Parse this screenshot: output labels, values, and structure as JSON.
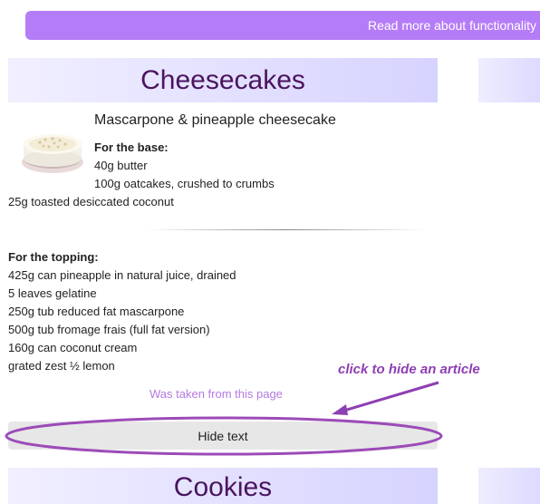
{
  "topbar": {
    "link_label": "Read more about functionality"
  },
  "section": {
    "title": "Cheesecakes"
  },
  "article": {
    "title": "Mascarpone & pineapple cheesecake",
    "base_heading": "For the base:",
    "base_items": [
      "40g butter",
      "100g oatcakes, crushed to crumbs",
      "25g toasted desiccated coconut"
    ],
    "topping_heading": "For the topping:",
    "topping_items": [
      "425g can pineapple in natural juice, drained",
      "5 leaves gelatine",
      "250g tub reduced fat mascarpone",
      "500g tub fromage frais (full fat version)",
      "160g can coconut cream",
      "grated zest ½ lemon"
    ],
    "source_link": "Was taken from this page",
    "hide_button": "Hide text"
  },
  "annotation": {
    "text": "click to hide an article"
  },
  "next_section": {
    "title": "Cookies"
  },
  "colors": {
    "accent": "#b57cf7",
    "title": "#4a145e",
    "annotation": "#8e3fb3",
    "link": "#b37ae0"
  }
}
